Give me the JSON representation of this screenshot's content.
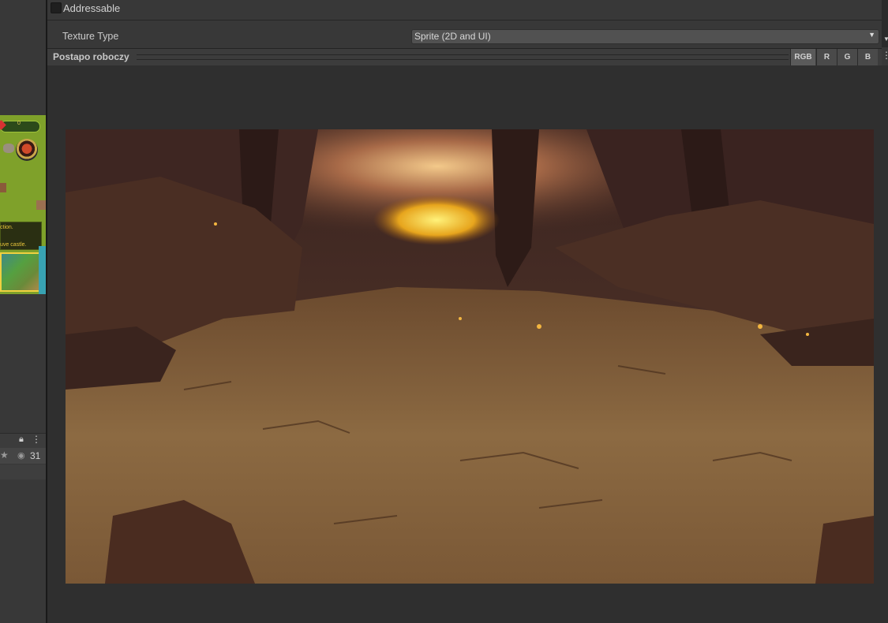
{
  "inspector": {
    "addressable_label": "Addressable",
    "addressable_checked": false,
    "texture_type_label": "Texture Type",
    "texture_type_value": "Sprite (2D and UI)"
  },
  "preview": {
    "title": "Postapo roboczy",
    "channels": [
      "RGB",
      "R",
      "G",
      "B"
    ],
    "more_icon": "kebab-icon",
    "image_description_icon": "cave-sprite"
  },
  "left_panel": {
    "thumb_text_1": "ction.",
    "thumb_text_2": "uve castle.",
    "thumb_counter": "0",
    "visible_count": "31",
    "lock_icon": "lock-icon",
    "star_icon": "star-icon",
    "eye_icon": "eye-icon"
  },
  "colors": {
    "background": "#383838",
    "preview_bg": "#2f2f2f",
    "dropdown_bg": "#515151",
    "accent_highlight": "#f0d040"
  }
}
